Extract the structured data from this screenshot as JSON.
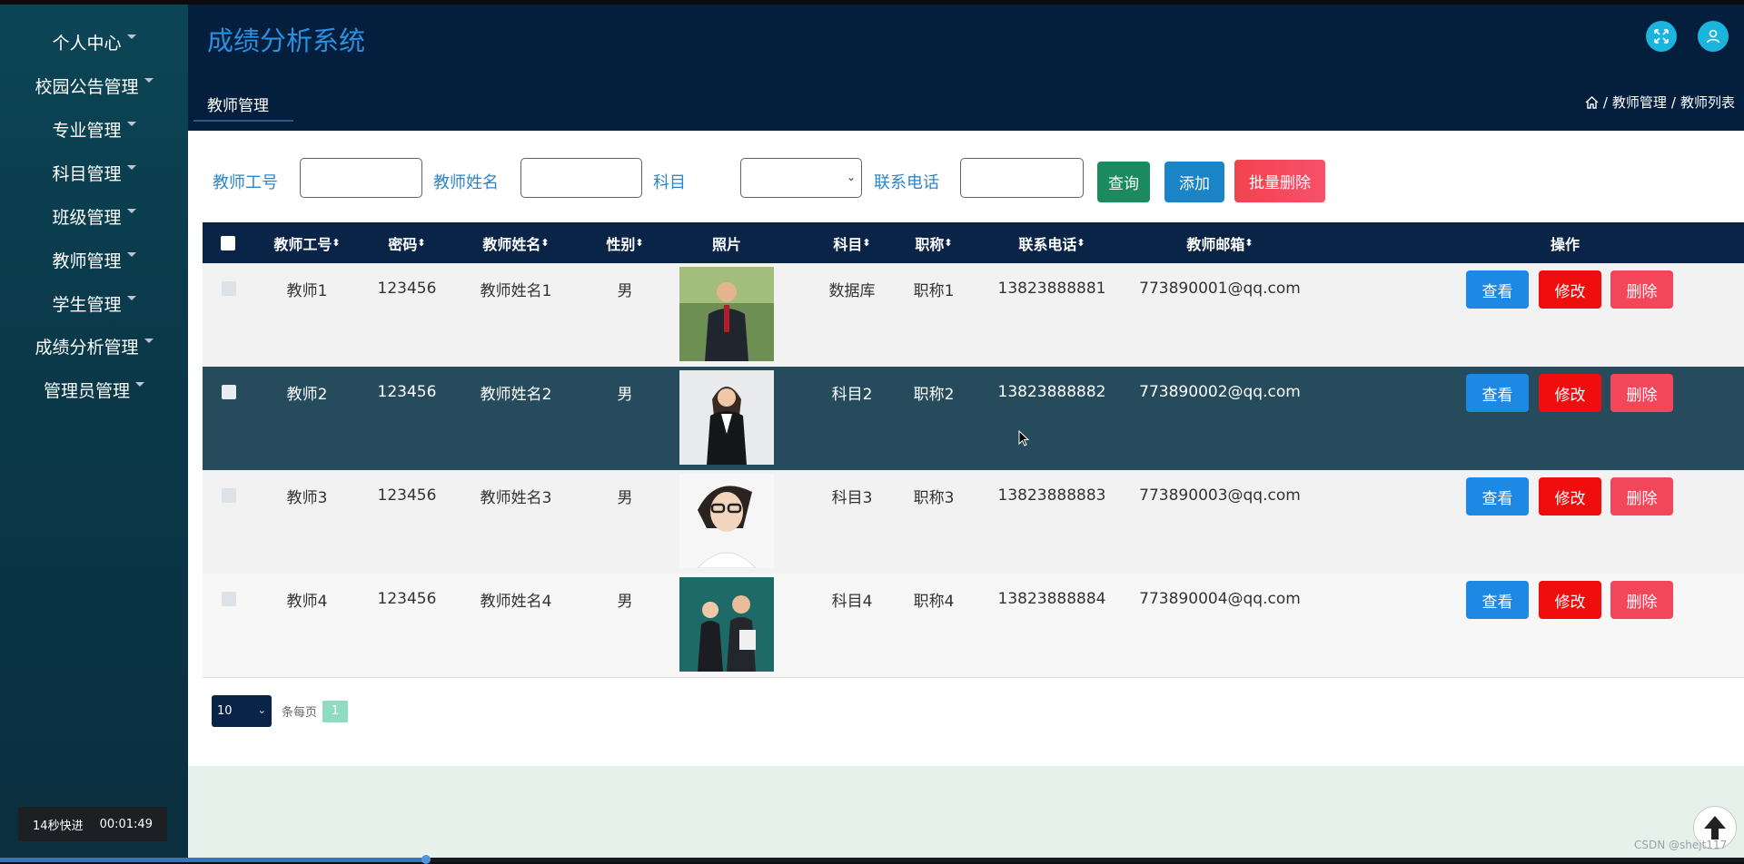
{
  "sidebar": {
    "items": [
      {
        "label": "个人中心"
      },
      {
        "label": "校园公告管理"
      },
      {
        "label": "专业管理"
      },
      {
        "label": "科目管理"
      },
      {
        "label": "班级管理"
      },
      {
        "label": "教师管理"
      },
      {
        "label": "学生管理"
      },
      {
        "label": "成绩分析管理"
      },
      {
        "label": "管理员管理"
      }
    ]
  },
  "header": {
    "title": "成绩分析系统",
    "active_tab": "教师管理",
    "breadcrumb": [
      "教师管理",
      "教师列表"
    ]
  },
  "search": {
    "labels": [
      "教师工号",
      "教师姓名",
      "科目",
      "联系电话"
    ],
    "buttons": {
      "query": "查询",
      "add": "添加",
      "batch_delete": "批量删除"
    }
  },
  "table": {
    "columns": [
      "教师工号",
      "密码",
      "教师姓名",
      "性别",
      "照片",
      "科目",
      "职称",
      "联系电话",
      "教师邮箱",
      "操作"
    ],
    "rows": [
      {
        "id": "教师1",
        "pwd": "123456",
        "name": "教师姓名1",
        "gender": "男",
        "subject": "数据库",
        "title": "职称1",
        "phone": "13823888881",
        "email": "773890001@qq.com"
      },
      {
        "id": "教师2",
        "pwd": "123456",
        "name": "教师姓名2",
        "gender": "男",
        "subject": "科目2",
        "title": "职称2",
        "phone": "13823888882",
        "email": "773890002@qq.com"
      },
      {
        "id": "教师3",
        "pwd": "123456",
        "name": "教师姓名3",
        "gender": "男",
        "subject": "科目3",
        "title": "职称3",
        "phone": "13823888883",
        "email": "773890003@qq.com"
      },
      {
        "id": "教师4",
        "pwd": "123456",
        "name": "教师姓名4",
        "gender": "男",
        "subject": "科目4",
        "title": "职称4",
        "phone": "13823888884",
        "email": "773890004@qq.com"
      }
    ],
    "actions": {
      "view": "查看",
      "edit": "修改",
      "delete": "删除"
    }
  },
  "pager": {
    "page_size": "10",
    "per_page_label": "条每页",
    "current_page": "1"
  },
  "player": {
    "speed_label": "14秒快进",
    "time": "00:01:49",
    "progress": 0.245
  },
  "watermark": "CSDN @shejt117",
  "colors": {
    "accent": "#2b8fe0",
    "view": "#1e88e5",
    "edit": "#ef0d0d",
    "delete": "#f2465a",
    "query": "#1b8a5e",
    "add": "#1a84c7",
    "batch": "#f2424f"
  }
}
